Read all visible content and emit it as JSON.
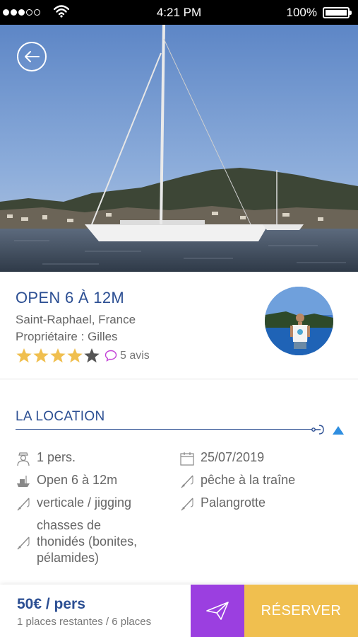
{
  "status_bar": {
    "time": "4:21 PM",
    "battery": "100%"
  },
  "listing": {
    "title": "OPEN 6 À 12M",
    "location": "Saint-Raphael, France",
    "owner": "Propriétaire : Gilles",
    "rating": 4,
    "rating_max": 5,
    "reviews_label": "5 avis"
  },
  "section": {
    "title": "LA LOCATION",
    "expanded": true
  },
  "details": {
    "persons": "1 pers.",
    "date": "25/07/2019",
    "boat": "Open 6 à 12m",
    "technique_1": "pêche à la traîne",
    "technique_2": "verticale / jigging",
    "technique_3": "Palangrotte",
    "technique_4_line1": "chasses de",
    "technique_4_line2": "thonidés (bonites,",
    "technique_4_line3": "pélamides)"
  },
  "booking": {
    "price": "50€ / pers",
    "places": "1 places restantes / 6 places",
    "reserve_label": "RÉSERVER"
  },
  "colors": {
    "brand_blue": "#2c4f93",
    "send_purple": "#9b3fe0",
    "reserve_yellow": "#f0bf4f",
    "star": "#f0bf4f"
  },
  "icons": {
    "back": "arrow-left-icon",
    "reviews": "speech-bubble-icon",
    "persons": "sailor-icon",
    "date": "calendar-icon",
    "boat": "boat-icon",
    "technique": "fishing-rod-icon",
    "send": "paper-plane-icon",
    "toggle": "triangle-up-icon"
  }
}
